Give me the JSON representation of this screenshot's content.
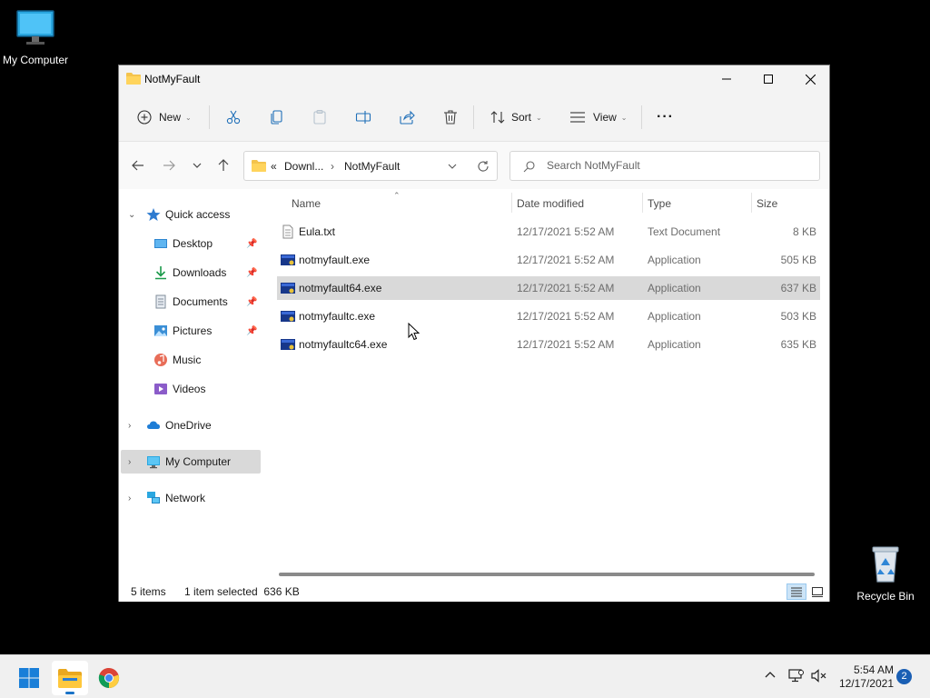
{
  "desktop": {
    "icons": [
      {
        "label": "My Computer",
        "icon": "monitor-icon"
      },
      {
        "label": "Recycle Bin",
        "icon": "recycle-bin-icon"
      }
    ]
  },
  "window": {
    "title": "NotMyFault",
    "controls": {
      "minimize": "minimize-icon",
      "maximize": "maximize-icon",
      "close": "close-icon"
    }
  },
  "toolbar": {
    "new_label": "New",
    "sort_label": "Sort",
    "view_label": "View",
    "more_label": "···",
    "actions": [
      "cut-icon",
      "copy-icon",
      "paste-icon",
      "rename-icon",
      "share-icon",
      "delete-icon"
    ]
  },
  "navigation": {
    "breadcrumb": {
      "prefix": "«",
      "items": [
        "Downl...",
        "NotMyFault"
      ],
      "separator": "›"
    },
    "search": {
      "placeholder": "Search NotMyFault"
    }
  },
  "sidebar": {
    "quick_access": "Quick access",
    "items": [
      {
        "label": "Desktop",
        "pinned": true
      },
      {
        "label": "Downloads",
        "pinned": true
      },
      {
        "label": "Documents",
        "pinned": true
      },
      {
        "label": "Pictures",
        "pinned": true
      },
      {
        "label": "Music",
        "pinned": false
      },
      {
        "label": "Videos",
        "pinned": false
      }
    ],
    "onedrive": "OneDrive",
    "my_computer": "My Computer",
    "network": "Network"
  },
  "file_list": {
    "columns": {
      "name": "Name",
      "date": "Date modified",
      "type": "Type",
      "size": "Size"
    },
    "rows": [
      {
        "name": "Eula.txt",
        "date": "12/17/2021 5:52 AM",
        "type": "Text Document",
        "size": "8 KB",
        "selected": false
      },
      {
        "name": "notmyfault.exe",
        "date": "12/17/2021 5:52 AM",
        "type": "Application",
        "size": "505 KB",
        "selected": false
      },
      {
        "name": "notmyfault64.exe",
        "date": "12/17/2021 5:52 AM",
        "type": "Application",
        "size": "637 KB",
        "selected": true
      },
      {
        "name": "notmyfaultc.exe",
        "date": "12/17/2021 5:52 AM",
        "type": "Application",
        "size": "503 KB",
        "selected": false
      },
      {
        "name": "notmyfaultc64.exe",
        "date": "12/17/2021 5:52 AM",
        "type": "Application",
        "size": "635 KB",
        "selected": false
      }
    ]
  },
  "status": {
    "item_count": "5 items",
    "selection": "1 item selected  636 KB"
  },
  "taskbar": {
    "time": "5:54 AM",
    "date": "12/17/2021",
    "notifications": "2"
  },
  "colors": {
    "folder": "#f4c34d",
    "accent": "#1a73c7",
    "selection": "#d9d9d9"
  }
}
